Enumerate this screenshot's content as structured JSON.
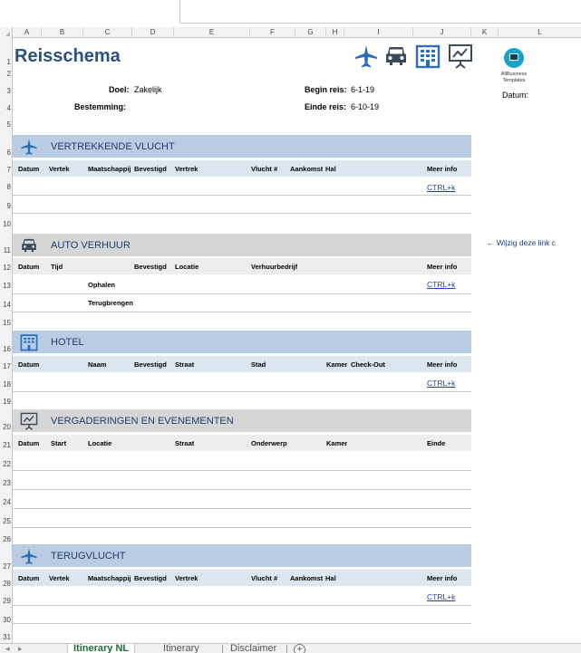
{
  "columns": [
    "A",
    "B",
    "C",
    "D",
    "E",
    "F",
    "G",
    "H",
    "I",
    "J",
    "K",
    "L"
  ],
  "rows": [
    "1",
    "2",
    "3",
    "4",
    "5",
    "6",
    "7",
    "8",
    "9",
    "10",
    "11",
    "12",
    "13",
    "14",
    "15",
    "16",
    "17",
    "18",
    "19",
    "20",
    "21",
    "22",
    "23",
    "24",
    "25",
    "26",
    "27",
    "28",
    "29",
    "30",
    "31"
  ],
  "title": "Reisschema",
  "header": {
    "doel_label": "Doel:",
    "doel_value": "Zakelijk",
    "bestemming_label": "Bestemming:",
    "begin_label": "Begin reis:",
    "begin_value": "6-1-19",
    "einde_label": "Einde reis:",
    "einde_value": "6-10-19"
  },
  "sections": {
    "departing": {
      "title": "VERTREKKENDE VLUCHT",
      "icon": "airplane-icon",
      "cols": [
        "Datum",
        "Vertek",
        "Maatschappij",
        "Bevestigd",
        "Vertrek",
        "Vlucht #",
        "Aankomst",
        "Hal",
        "Meer info"
      ],
      "link": "CTRL+k"
    },
    "car": {
      "title": "AUTO VERHUUR",
      "icon": "car-icon",
      "cols": [
        "Datum",
        "Tijd",
        "Bevestigd",
        "Locatie",
        "Verhuurbedrijf",
        "Meer info"
      ],
      "pickup": "Ophalen",
      "return": "Terugbrengen",
      "link": "CTRL+k"
    },
    "hotel": {
      "title": "HOTEL",
      "icon": "hotel-icon",
      "cols": [
        "Datum",
        "Naam",
        "Bevestigd",
        "Straat",
        "Stad",
        "Kamer",
        "Check-Out",
        "Meer info"
      ],
      "link": "CTRL+k"
    },
    "meetings": {
      "title": "VERGADERINGEN EN EVENEMENTEN",
      "icon": "presentation-icon",
      "cols": [
        "Datum",
        "Start",
        "Locatie",
        "Straat",
        "Onderwerp",
        "Kamer",
        "Einde"
      ]
    },
    "return_flight": {
      "title": "TERUGVLUCHT",
      "icon": "airplane-icon",
      "cols": [
        "Datum",
        "Vertek",
        "Maatschappij",
        "Bevestigd",
        "Vertrek",
        "Vlucht #",
        "Aankomst",
        "Hal",
        "Meer info"
      ],
      "link": "CTRL+k"
    }
  },
  "side": {
    "logo_line1": "AllBusiness",
    "logo_line2": "Templates",
    "datum_label": "Datum:",
    "note": "← Wijzig deze link c"
  },
  "tabs": [
    "Itinerary NL",
    "Itinerary",
    "Disclaimer"
  ],
  "active_tab": "Itinerary NL",
  "add_tab": "+",
  "colors": {
    "title": "#2e4e7e",
    "band_blue": "#b8cce4",
    "band_grey": "#d6d6d6",
    "icon_blue": "#2a6ebb",
    "icon_grey": "#3d4a5a",
    "link": "#1f3fb8"
  }
}
